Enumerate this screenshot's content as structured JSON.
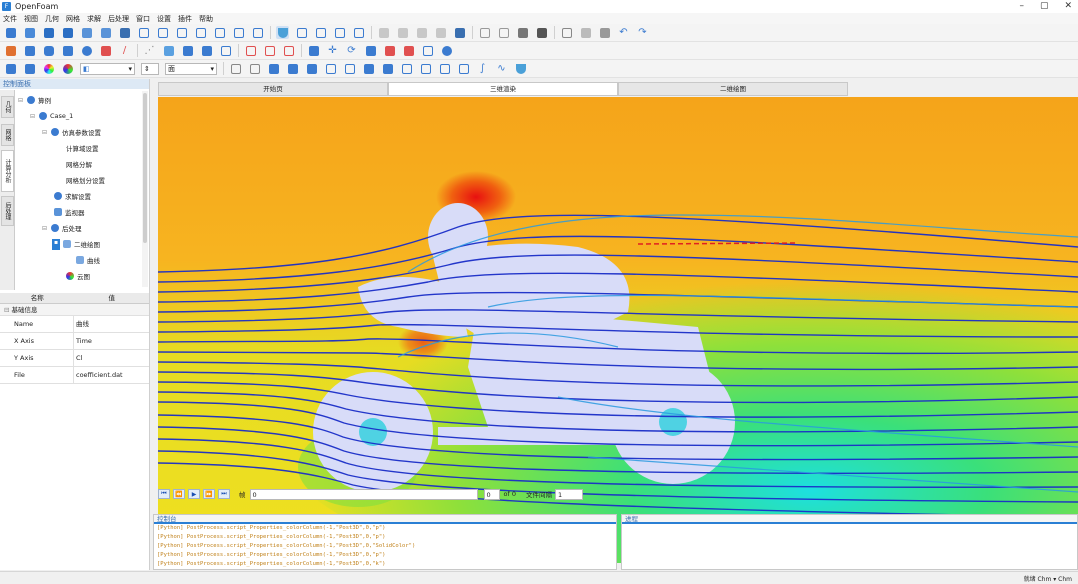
{
  "window": {
    "title": "OpenFoam"
  },
  "menu": [
    "文件",
    "视图",
    "几何",
    "网格",
    "求解",
    "后处理",
    "窗口",
    "设置",
    "插件",
    "帮助"
  ],
  "toolbar3": {
    "combo_style": "面"
  },
  "left_panel": {
    "title": "控制面板",
    "vertical_tabs": [
      "几何",
      "网格",
      "计算分析",
      "后处理"
    ],
    "tree": [
      {
        "label": "算例",
        "icon": "user-icon"
      },
      {
        "label": "Case_1",
        "icon": "user-icon"
      },
      {
        "label": "仿真参数设置",
        "icon": "gear-icon"
      },
      {
        "label": "计算域设置",
        "icon": ""
      },
      {
        "label": "网格分解",
        "icon": ""
      },
      {
        "label": "网格划分设置",
        "icon": ""
      },
      {
        "label": "求解设置",
        "icon": "gear-icon"
      },
      {
        "label": "监视器",
        "icon": "monitor-icon"
      },
      {
        "label": "后处理",
        "icon": "gear-icon"
      },
      {
        "label": "二维绘图",
        "icon": "chart-icon"
      },
      {
        "label": "曲线",
        "icon": "chart-icon"
      },
      {
        "label": "云图",
        "icon": "palette-icon"
      }
    ]
  },
  "properties": {
    "col_name": "名称",
    "col_value": "值",
    "group": "基础信息",
    "rows": [
      {
        "k": "Name",
        "v": "曲线"
      },
      {
        "k": "X Axis",
        "v": "Time"
      },
      {
        "k": "Y Axis",
        "v": "Cl"
      },
      {
        "k": "File",
        "v": "coefficient.dat"
      }
    ]
  },
  "tabs": [
    "开始页",
    "三维渲染",
    "二维绘图"
  ],
  "playbar": {
    "frame_label": "帧",
    "frame_value": "0",
    "index_value": "0",
    "of_label": "of 0",
    "interval_label": "文件间隔",
    "interval_value": "1"
  },
  "console": {
    "title": "控制台",
    "lines": [
      "[Python]   PostProcess.script_Properties_colorColumn(-1,\"Post3D\",0,\"p\")",
      "[Python]   PostProcess.script_Properties_colorColumn(-1,\"Post3D\",0,\"p\")",
      "[Python]   PostProcess.script_Properties_colorColumn(-1,\"Post3D\",0,\"SolidColor\")",
      "[Python]   PostProcess.script_Properties_colorColumn(-1,\"Post3D\",0,\"p\")",
      "[Python]   PostProcess.script_Properties_colorColumn(-1,\"Post3D\",0,\"k\")"
    ]
  },
  "progress": {
    "title": "进程"
  },
  "status": {
    "text": "就绪 Chm ▾ Chm"
  }
}
